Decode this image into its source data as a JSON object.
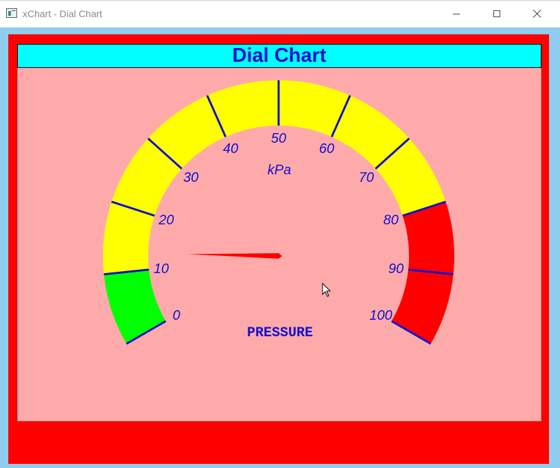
{
  "window": {
    "title": "xChart - Dial Chart",
    "controls": [
      "minimize",
      "maximize",
      "close"
    ]
  },
  "colors": {
    "frame": "#8ecdee",
    "panel": "#ff0000",
    "plot": "#ffaaaa",
    "title_bg": "#00ffff",
    "text": "#1010d0",
    "needle": "#ff0000"
  },
  "chart_data": {
    "type": "dial",
    "title": "Dial Chart",
    "units": "kPa",
    "label": "PRESSURE",
    "min": 0,
    "max": 100,
    "start_angle_deg": 210,
    "end_angle_deg": -30,
    "ticks": [
      0,
      10,
      20,
      30,
      40,
      50,
      60,
      70,
      80,
      90,
      100
    ],
    "tick_labels": [
      "0",
      "10",
      "20",
      "30",
      "40",
      "50",
      "60",
      "70",
      "80",
      "90",
      "100"
    ],
    "bands": [
      {
        "from": 0,
        "to": 10,
        "color": "#00ff00"
      },
      {
        "from": 10,
        "to": 80,
        "color": "#ffff00"
      },
      {
        "from": 80,
        "to": 100,
        "color": "#ff0000"
      }
    ],
    "value": 13
  }
}
